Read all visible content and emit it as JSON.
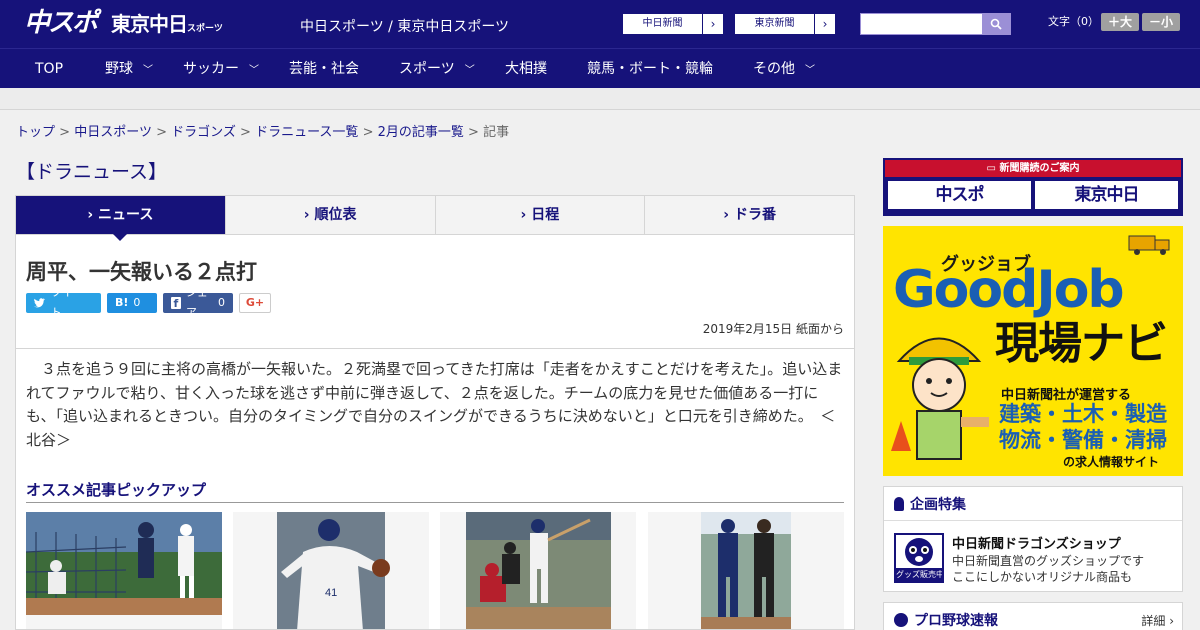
{
  "header": {
    "logo_primary": "中スポ",
    "logo_secondary": "東京中日",
    "logo_secondary_small": "スポーツ",
    "site_name": "中日スポーツ / 東京中日スポーツ",
    "ext_links": [
      {
        "label": "中日新聞",
        "arrow": "›"
      },
      {
        "label": "東京新聞",
        "arrow": "›"
      }
    ],
    "search_placeholder": "",
    "font_size_label": "文字（0）",
    "font_bigger": "＋大",
    "font_smaller": "－小"
  },
  "nav": {
    "items": [
      {
        "label": "TOP",
        "has_sub": false
      },
      {
        "label": "野球",
        "has_sub": true
      },
      {
        "label": "サッカー",
        "has_sub": true
      },
      {
        "label": "芸能・社会",
        "has_sub": false
      },
      {
        "label": "スポーツ",
        "has_sub": true
      },
      {
        "label": "大相撲",
        "has_sub": false
      },
      {
        "label": "競馬・ボート・競輪",
        "has_sub": false
      },
      {
        "label": "その他",
        "has_sub": true
      }
    ]
  },
  "breadcrumb": {
    "links": [
      "トップ",
      "中日スポーツ",
      "ドラゴンズ",
      "ドラニュース一覧",
      "2月の記事一覧"
    ],
    "current": "記事",
    "separator": ">"
  },
  "section_title": "【ドラニュース】",
  "tabs": [
    {
      "label": "ニュース",
      "active": true
    },
    {
      "label": "順位表",
      "active": false
    },
    {
      "label": "日程",
      "active": false
    },
    {
      "label": "ドラ番",
      "active": false
    }
  ],
  "article": {
    "headline": "周平、一矢報いる２点打",
    "share": {
      "tweet": "ツイート",
      "hatena_count": "0",
      "facebook": "シェア",
      "facebook_count": "0",
      "gplus": "G+"
    },
    "date": "2019年2月15日 紙面から",
    "body": "　３点を追う９回に主将の高橋が一矢報いた。２死満塁で回ってきた打席は「走者をかえすことだけを考えた」。追い込まれてファウルで粘り、甘く入った球を逃さず中前に弾き返して、２点を返した。チームの底力を見せた価値ある一打にも、「追い込まれるときつい。自分のタイミングで自分のスイングができるうちに決めないと」と口元を引き締めた。　＜北谷＞"
  },
  "pickup": {
    "title": "オススメ記事ピックアップ"
  },
  "sidebar": {
    "subscribe_header": "新聞購読のご案内",
    "subscribe_buttons": [
      "中スポ",
      "東京中日"
    ],
    "ad": {
      "small": "グッジョブ",
      "big": "GoodJob",
      "title": "現場ナビ",
      "operator": "中日新聞社が運営する",
      "line1": "建築・土木・製造",
      "line2": "物流・警備・清掃",
      "tag": "の求人情報サイト"
    },
    "feature": {
      "title": "企画特集",
      "item_title": "中日新聞ドラゴンズショップ",
      "item_desc1": "中日新聞直営のグッズショップです",
      "item_desc2": "ここにしかないオリジナル商品も",
      "badge": "グッズ販売中"
    },
    "baseball": {
      "title": "プロ野球速報",
      "more": "詳細 ›"
    }
  },
  "colors": {
    "brand": "#16127a",
    "accent_red": "#c8102e",
    "ad_yellow": "#ffe400",
    "ad_blue": "#1a5fb4",
    "twitter": "#2aa2e5",
    "facebook": "#3b5998"
  }
}
